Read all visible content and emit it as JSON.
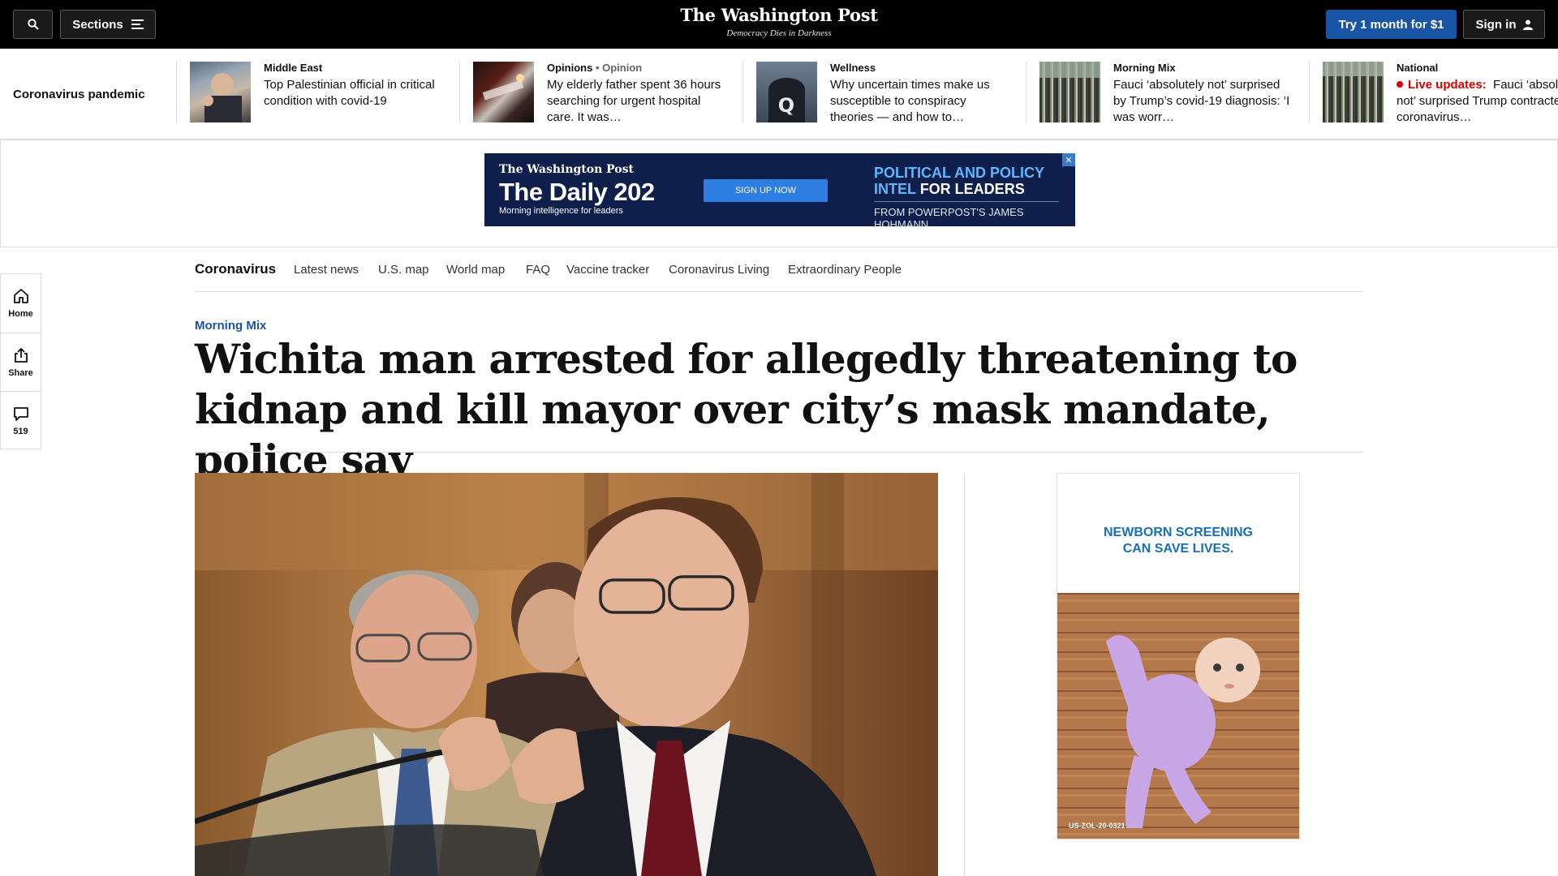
{
  "header": {
    "sections_label": "Sections",
    "logo": "The Washington Post",
    "tagline": "Democracy Dies in Darkness",
    "subscribe_label": "Try 1 month for $1",
    "signin_label": "Sign in",
    "icons": [
      "search-icon",
      "menu-icon",
      "user-icon"
    ]
  },
  "strip": {
    "label": "Coronavirus pandemic",
    "items": [
      {
        "kicker": "Middle East",
        "kicker_suffix": "",
        "headline": "Top Palestinian official in critical condition with covid-19",
        "live": ""
      },
      {
        "kicker": "Opinions",
        "kicker_suffix": "• Opinion",
        "headline": "My elderly father spent 36 hours searching for urgent hospital care. It was…",
        "live": ""
      },
      {
        "kicker": "Wellness",
        "kicker_suffix": "",
        "headline": "Why uncertain times make us susceptible to conspiracy theories — and how to…",
        "live": ""
      },
      {
        "kicker": "Morning Mix",
        "kicker_suffix": "",
        "headline": "Fauci ‘absolutely not’ surprised by Trump’s covid-19 diagnosis: ‘I was worr…",
        "live": ""
      },
      {
        "kicker": "National",
        "kicker_suffix": "",
        "headline": "Fauci ‘absolutely not’ surprised Trump contracted coronavirus…",
        "live": "Live updates:"
      }
    ]
  },
  "top_ad": {
    "brand": "The Washington Post",
    "title": "The Daily 202",
    "subtitle": "Morning intelligence for leaders",
    "cta": "SIGN UP NOW",
    "pitch_line1": "POLITICAL AND POLICY",
    "pitch_line2a": "INTEL",
    "pitch_line2b": "FOR LEADERS",
    "byline": "FROM POWERPOST'S JAMES HOHMANN",
    "close": "✕"
  },
  "section_nav": {
    "title": "Coronavirus",
    "links": [
      "Latest news",
      "U.S. map",
      "World map",
      "FAQ",
      "Vaccine tracker",
      "Coronavirus Living",
      "Extraordinary People"
    ]
  },
  "rail": {
    "home": "Home",
    "share": "Share",
    "comments": "519"
  },
  "article": {
    "kicker": "Morning Mix",
    "headline": "Wichita man arrested for allegedly threatening to kidnap and kill mayor over city’s mask mandate, police say"
  },
  "side_ad": {
    "line1": "NEWBORN SCREENING",
    "line2": "CAN SAVE LIVES.",
    "code": "US-ZOL-20-0321"
  },
  "colors": {
    "topbar": "#000000",
    "accent_blue": "#1955a5",
    "live_red": "#e00000",
    "ad_navy": "#0d1f4a"
  }
}
